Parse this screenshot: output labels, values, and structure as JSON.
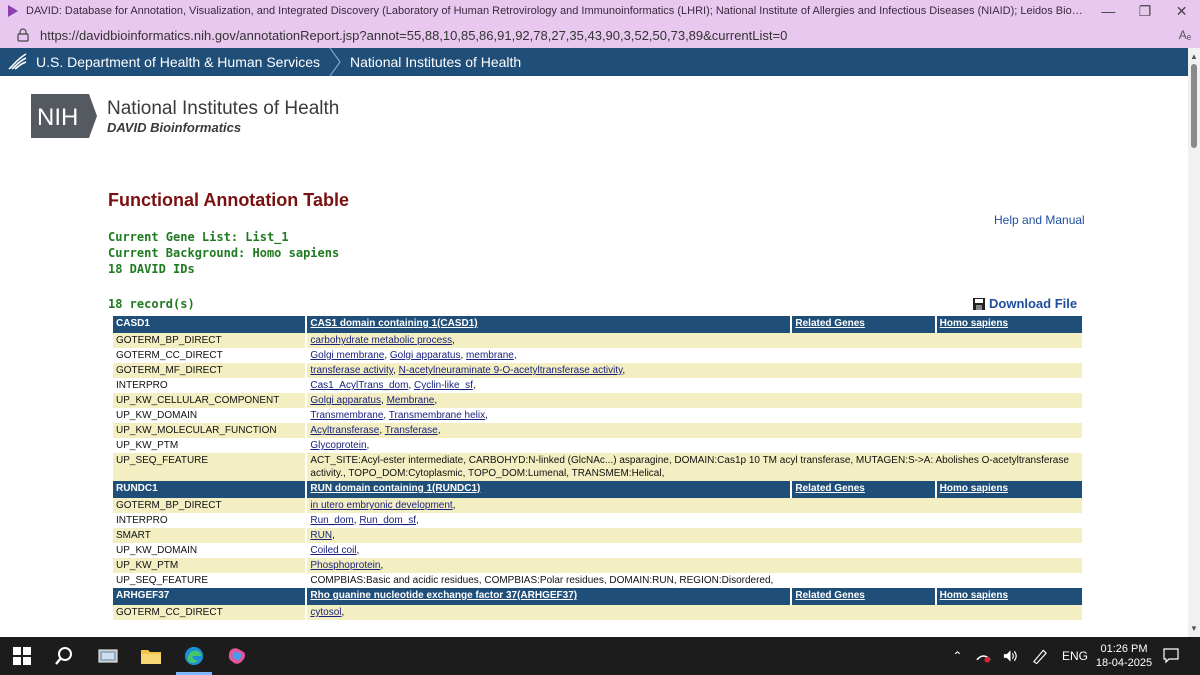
{
  "window": {
    "title": "DAVID: Database for Annotation, Visualization, and Integrated Discovery (Laboratory of Human Retrovirology and Immunoinformatics (LHRI); National Institute of Allergies and Infectious Diseases (NIAID); Leidos Biomedical Res...",
    "url": "https://davidbioinformatics.nih.gov/annotationReport.jsp?annot=55,88,10,85,86,91,92,78,27,35,43,90,3,52,50,73,89&currentList=0",
    "read_aloud": "Aₑ"
  },
  "hhs_bar": {
    "hhs": "U.S. Department of Health & Human Services",
    "nih": "National Institutes of Health"
  },
  "logo": {
    "mark": "NIH",
    "name": "National Institutes of Health",
    "sub": "DAVID Bioinformatics"
  },
  "page": {
    "title": "Functional Annotation Table",
    "help": "Help and Manual",
    "gene_list": "Current Gene List: List_1",
    "background": "Current Background: Homo sapiens",
    "ids": "18 DAVID IDs",
    "records": "18 record(s)",
    "download": "Download File"
  },
  "genes": [
    {
      "id": "CASD1",
      "name": "CAS1 domain containing 1(CASD1)",
      "related": "Related Genes",
      "species": "Homo sapiens",
      "rows": [
        {
          "cat": "GOTERM_BP_DIRECT",
          "terms": [
            "carbohydrate metabolic process"
          ]
        },
        {
          "cat": "GOTERM_CC_DIRECT",
          "terms": [
            "Golgi membrane",
            "Golgi apparatus",
            "membrane"
          ]
        },
        {
          "cat": "GOTERM_MF_DIRECT",
          "terms": [
            "transferase activity",
            "N-acetylneuraminate 9-O-acetyltransferase activity"
          ]
        },
        {
          "cat": "INTERPRO",
          "terms": [
            "Cas1_AcylTrans_dom",
            "Cyclin-like_sf"
          ]
        },
        {
          "cat": "UP_KW_CELLULAR_COMPONENT",
          "terms": [
            "Golgi apparatus",
            "Membrane"
          ]
        },
        {
          "cat": "UP_KW_DOMAIN",
          "terms": [
            "Transmembrane",
            "Transmembrane helix"
          ]
        },
        {
          "cat": "UP_KW_MOLECULAR_FUNCTION",
          "terms": [
            "Acyltransferase",
            "Transferase"
          ]
        },
        {
          "cat": "UP_KW_PTM",
          "terms": [
            "Glycoprotein"
          ]
        },
        {
          "cat": "UP_SEQ_FEATURE",
          "plain": "ACT_SITE:Acyl-ester intermediate, CARBOHYD:N-linked (GlcNAc...) asparagine, DOMAIN:Cas1p 10 TM acyl transferase, MUTAGEN:S->A: Abolishes O-acetyltransferase activity., TOPO_DOM:Cytoplasmic, TOPO_DOM:Lumenal, TRANSMEM:Helical,"
        }
      ]
    },
    {
      "id": "RUNDC1",
      "name": "RUN domain containing 1(RUNDC1)",
      "related": "Related Genes",
      "species": "Homo sapiens",
      "rows": [
        {
          "cat": "GOTERM_BP_DIRECT",
          "terms": [
            "in utero embryonic development"
          ]
        },
        {
          "cat": "INTERPRO",
          "terms": [
            "Run_dom",
            "Run_dom_sf"
          ]
        },
        {
          "cat": "SMART",
          "terms": [
            "RUN"
          ]
        },
        {
          "cat": "UP_KW_DOMAIN",
          "terms": [
            "Coiled coil"
          ]
        },
        {
          "cat": "UP_KW_PTM",
          "terms": [
            "Phosphoprotein"
          ]
        },
        {
          "cat": "UP_SEQ_FEATURE",
          "plain": "COMPBIAS:Basic and acidic residues, COMPBIAS:Polar residues, DOMAIN:RUN, REGION:Disordered,"
        }
      ]
    },
    {
      "id": "ARHGEF37",
      "name": "Rho guanine nucleotide exchange factor 37(ARHGEF37)",
      "related": "Related Genes",
      "species": "Homo sapiens",
      "rows": [
        {
          "cat": "GOTERM_CC_DIRECT",
          "terms": [
            "cytosol"
          ]
        }
      ]
    }
  ],
  "taskbar": {
    "lang": "ENG",
    "time": "01:26 PM",
    "date": "18-04-2025"
  }
}
